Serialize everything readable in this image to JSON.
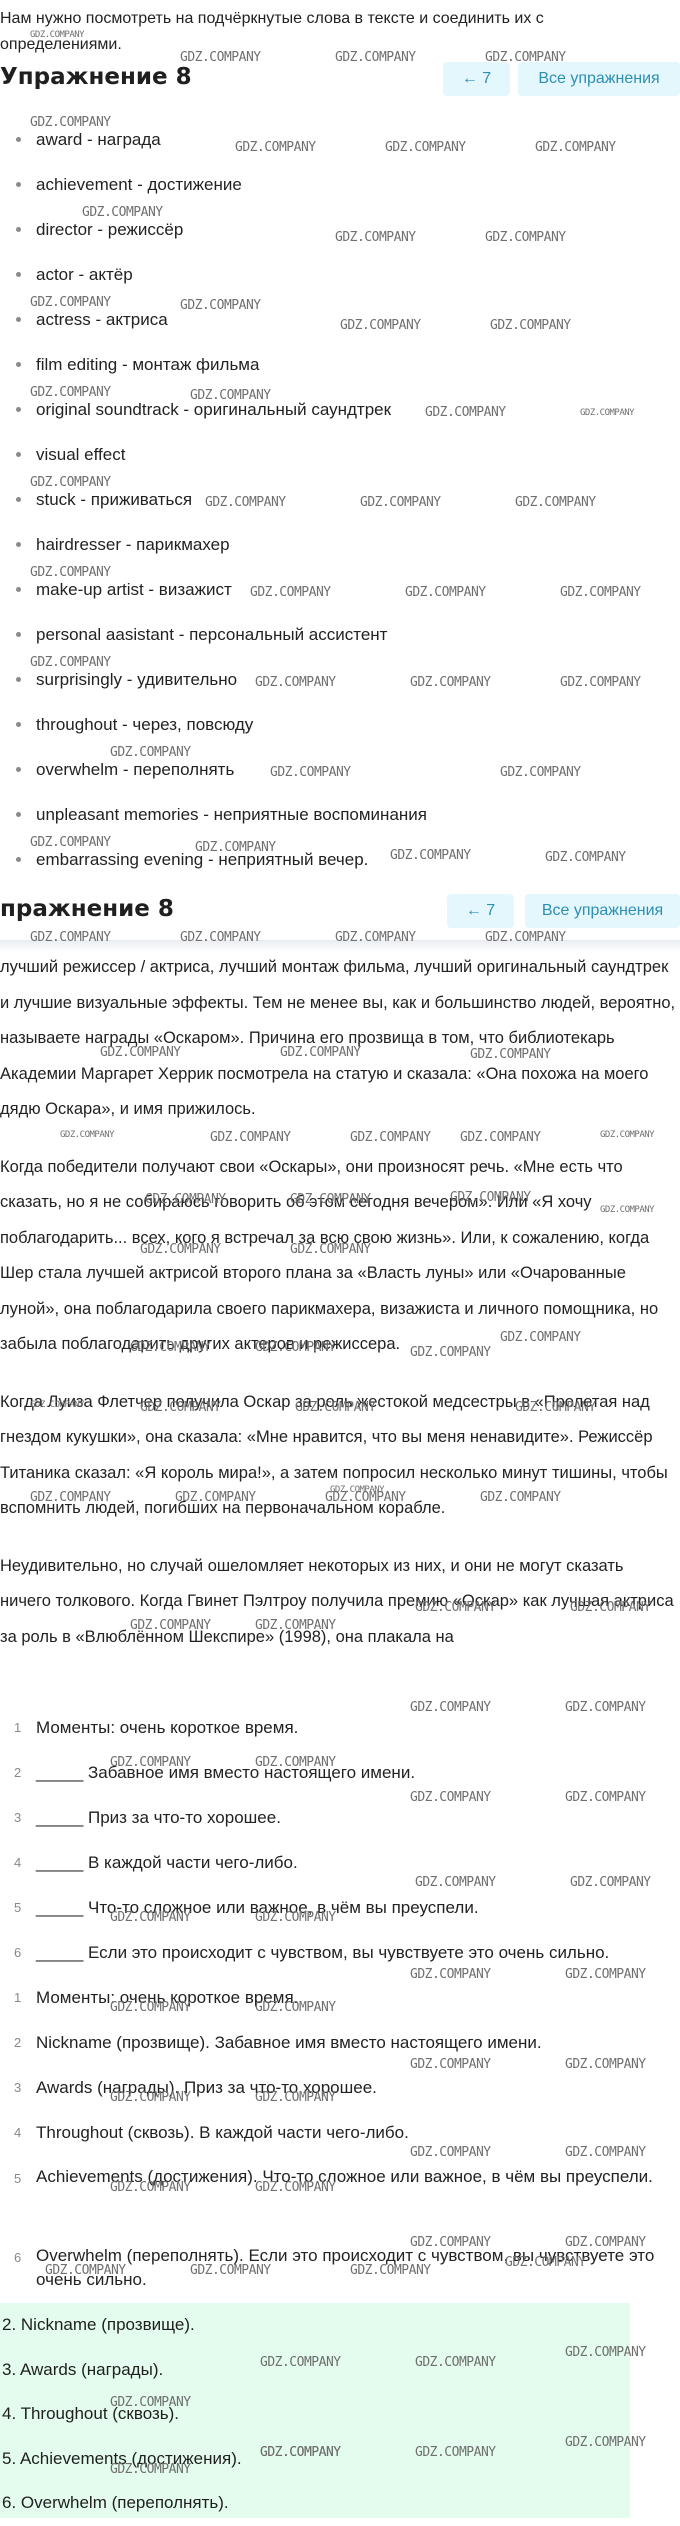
{
  "intro": "Нам нужно посмотреть на подчёркнутые слова в тексте и соединить их с определениями.",
  "header": {
    "title": "Упражнение 8",
    "back_label": "← 7",
    "all_label": "Все упражнения"
  },
  "header2": {
    "title": "пражнение 8",
    "back_label": "← 7",
    "all_label": "Все упражнения"
  },
  "vocab": [
    "award - награда",
    "achievement - достижение",
    "director - режиссёр",
    "actor - актёр",
    "actress - актриса",
    "film editing - монтаж фильма",
    "original soundtrack - оригинальный саундтрек",
    "visual effect",
    "stuck - приживаться",
    "hairdresser - парикмахер",
    "make-up artist - визажист",
    "personal aasistant - персональный ассистент",
    "surprisingly - удивительно",
    "throughout - через, повсюду",
    "overwhelm - переполнять",
    "unpleasant memories - неприятные воспоминания",
    "embarrassing evening - неприятный вечер."
  ],
  "text_paragraphs": [
    "лучший режиссер / актриса, лучший монтаж фильма, лучший оригинальный саундтрек и лучшие визуальные эффекты. Тем не менее вы, как и большинство людей, вероятно, называете награды «Оскаром». Причина его прозвища в том, что библиотекарь Академии Маргарет Херрик посмотрела на статую и сказала: «Она похожа на моего дядю Оскара», и имя прижилось.",
    "Когда победители получают свои «Оскары», они произносят речь. «Мне есть что сказать, но я не собираюсь говорить об этом сегодня вечером». Или «Я хочу поблагодарить... всех, кого я встречал за всю свою жизнь». Или, к сожалению, когда Шер стала лучшей актрисой второго плана за «Власть луны» или «Очарованные луной», она поблагодарила своего парикмахера, визажиста и личного помощника, но забыла поблагодарить других актеров и режиссера.",
    "Когда Луиза Флетчер получила Оскар за роль жестокой медсестры в «Пролетая над гнездом кукушки», она сказала: «Мне нравится, что вы меня ненавидите». Режиссёр Титаника сказал: «Я король мира!», а затем попросил несколько минут тишины, чтобы вспомнить людей, погибших на первоначальном корабле.",
    "Неудивительно, но случай ошеломляет некоторых из них, и они не могут сказать ничего толкового. Когда Гвинет Пэлтроу получила премию «Оскар» как лучшая актриса за роль в «Влюблённом Шекспире» (1998), она плакала на"
  ],
  "exercise1": [
    "Моменты: очень короткое время.",
    "_____ Забавное имя вместо настоящего имени.",
    "_____ Приз за что-то хорошее.",
    "_____ В каждой части чего-либо.",
    "_____ Что-то сложное или важное, в чём вы преуспели.",
    "_____ Если это происходит с чувством, вы чувствуете это очень сильно."
  ],
  "exercise2": [
    "Моменты: очень короткое время.",
    "Nickname (прозвище). Забавное имя вместо настоящего имени.",
    "Awards (награды). Приз за что-то хорошее.",
    "Throughout (сквозь). В каждой части чего-либо.",
    " Achievements (достижения). Что-то сложное или важное, в чём вы преуспели.",
    "Overwhelm (переполнять). Если это происходит с чувством, вы чувствуете это очень сильно."
  ],
  "answers": [
    "2. Nickname (прозвище).",
    "3. Awards (награды).",
    "4. Throughout (сквозь).",
    "5. Achievements (достижения).",
    "6. Overwhelm (переполнять)."
  ],
  "watermark": "GDZ.COMPANY"
}
